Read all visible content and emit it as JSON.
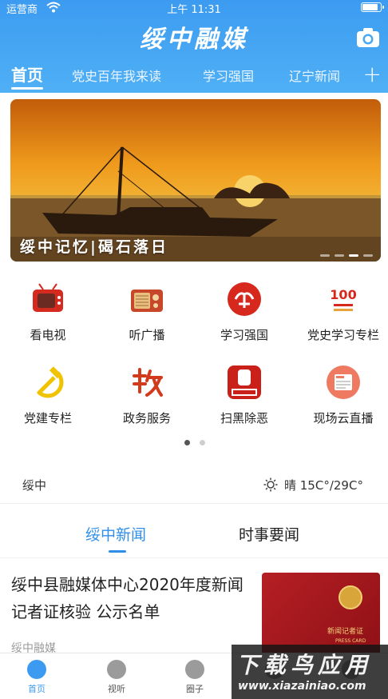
{
  "status_bar": {
    "carrier": "运营商",
    "time": "上午 11:31",
    "battery_level": 0.9
  },
  "header": {
    "app_title": "绥中融媒",
    "tabs": [
      {
        "label": "首页",
        "active": true
      },
      {
        "label": "党史百年我来读"
      },
      {
        "label": "学习强国"
      },
      {
        "label": "辽宁新闻"
      }
    ]
  },
  "banner": {
    "caption": "绥中记忆|碣石落日",
    "slide_count": 4,
    "active_slide": 3
  },
  "shortcuts": [
    {
      "label": "看电视",
      "icon": "tv-icon"
    },
    {
      "label": "听广播",
      "icon": "radio-icon"
    },
    {
      "label": "学习强国",
      "icon": "xuexi-icon"
    },
    {
      "label": "党史学习专栏",
      "icon": "party-history-icon"
    },
    {
      "label": "党建专栏",
      "icon": "hammer-sickle-icon"
    },
    {
      "label": "政务服务",
      "icon": "government-icon"
    },
    {
      "label": "扫黑除恶",
      "icon": "anti-crime-icon"
    },
    {
      "label": "现场云直播",
      "icon": "live-news-icon"
    }
  ],
  "shortcut_pages": {
    "count": 2,
    "active": 1
  },
  "weather": {
    "city": "绥中",
    "text": "晴 15C°/29C°",
    "icon": "sun-icon"
  },
  "news_tabs": [
    {
      "label": "绥中新闻",
      "active": true
    },
    {
      "label": "时事要闻"
    }
  ],
  "article": {
    "title": "绥中县融媒体中心2020年度新闻记者证核验 公示名单",
    "source": "绥中融媒",
    "thumb_text": "新闻记者证",
    "thumb_sub": "PRESS CARD"
  },
  "tabbar": [
    {
      "label": "首页",
      "icon": "home-icon",
      "active": true
    },
    {
      "label": "视听",
      "icon": "play-icon"
    },
    {
      "label": "圈子",
      "icon": "circle-icon"
    },
    {
      "label": "",
      "icon": "service-icon"
    },
    {
      "label": "",
      "icon": "profile-icon"
    }
  ],
  "watermark": {
    "title": "下载鸟应用",
    "url": "www.xiazainiao.com"
  },
  "colors": {
    "header": "#3c9bf0",
    "accent": "#2f8fe8"
  }
}
